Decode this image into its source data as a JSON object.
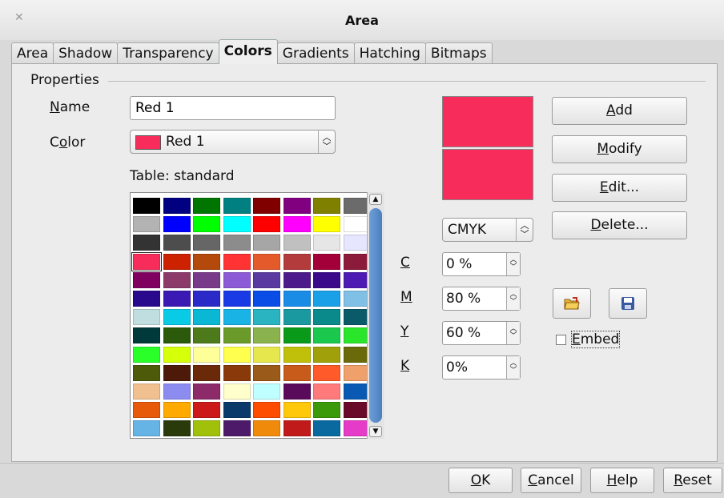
{
  "window": {
    "title": "Area"
  },
  "tabs": [
    {
      "label": "Area"
    },
    {
      "label": "Shadow"
    },
    {
      "label": "Transparency"
    },
    {
      "label": "Colors",
      "active": true
    },
    {
      "label": "Gradients"
    },
    {
      "label": "Hatching"
    },
    {
      "label": "Bitmaps"
    }
  ],
  "properties": {
    "section_title": "Properties",
    "name_label_u": "N",
    "name_label_rest": "ame",
    "name_value": "Red 1",
    "color_label_pre": "C",
    "color_label_u": "o",
    "color_label_rest": "lor",
    "color_value": "Red 1",
    "table_label": "Table: standard"
  },
  "palette": [
    "#000000",
    "#000080",
    "#007500",
    "#008080",
    "#800000",
    "#800080",
    "#808000",
    "#6b6b6b",
    "#b3b3b3",
    "#0000ff",
    "#00ff00",
    "#00ffff",
    "#ff0000",
    "#ff00ff",
    "#ffff00",
    "#ffffff",
    "#333333",
    "#4d4d4d",
    "#666666",
    "#8c8c8c",
    "#a6a6a6",
    "#c0c0c0",
    "#e6e6e6",
    "#e6e6ff",
    "#f72c5a",
    "#cc2200",
    "#b3490b",
    "#ff3333",
    "#e45a2a",
    "#b33b3b",
    "#a3003a",
    "#8c1a3a",
    "#800060",
    "#8c3a6a",
    "#7a3a8a",
    "#8c5ad6",
    "#5a3aa0",
    "#4d1a8c",
    "#3a0a8a",
    "#4d1ab3",
    "#2a0a8c",
    "#3a1ab3",
    "#2a2ac8",
    "#1a3ae6",
    "#0a4de6",
    "#1a8ce6",
    "#1aa0e6",
    "#80c0e6",
    "#c0dde0",
    "#0acbe6",
    "#0ab8d6",
    "#1ab3e6",
    "#2ab3c0",
    "#1a9aa0",
    "#0a8a8a",
    "#0a5a6a",
    "#003a3a",
    "#2a5a0a",
    "#4d7a1a",
    "#6a9a2a",
    "#8ab34d",
    "#0a9a1a",
    "#1ac84d",
    "#2ae62a",
    "#2aff2a",
    "#d6ff0a",
    "#ffff9a",
    "#ffff4d",
    "#e6e64d",
    "#c0c00a",
    "#a0a00a",
    "#6a6a0a",
    "#4d5a0a",
    "#4d1a0a",
    "#6a2a0a",
    "#8a3a0a",
    "#9a5a1a",
    "#c85a1a",
    "#ff5a2a",
    "#f0a06a",
    "#f0c090",
    "#8c8cf0",
    "#8c2a6a",
    "#ffffcc",
    "#c0ffff",
    "#5a0a5a",
    "#ff7a7a",
    "#0a5ab3",
    "#e65a0a",
    "#ffaa00",
    "#cc1a1a",
    "#0a3a6a",
    "#ff4d00",
    "#ffc80a",
    "#3a9a0a",
    "#6a0a2a",
    "#66b3e6",
    "#2a3a0a",
    "#a0c00a",
    "#4d1a6a",
    "#f08a0a",
    "#c01a1a",
    "#0a6aa0",
    "#e63ac8"
  ],
  "selected_color_index": 24,
  "preview": {
    "color": "#f72c5a"
  },
  "model": {
    "value": "CMYK"
  },
  "cmyk": [
    {
      "label": "C",
      "value": "0 %"
    },
    {
      "label": "M",
      "value": "80 %"
    },
    {
      "label": "Y",
      "value": "60 %"
    },
    {
      "label": "K",
      "value": "0%"
    }
  ],
  "buttons": {
    "add_u": "A",
    "add_rest": "dd",
    "modify_u": "M",
    "modify_rest": "odify",
    "edit_u": "E",
    "edit_rest": "dit...",
    "delete_u": "D",
    "delete_rest": "elete..."
  },
  "embed": {
    "pre": "",
    "u": "E",
    "rest": "mbed",
    "checked": false
  },
  "footer": {
    "ok_u": "O",
    "ok_rest": "K",
    "cancel_u": "C",
    "cancel_rest": "ancel",
    "help_u": "H",
    "help_rest": "elp",
    "reset_u": "R",
    "reset_rest": "eset"
  }
}
